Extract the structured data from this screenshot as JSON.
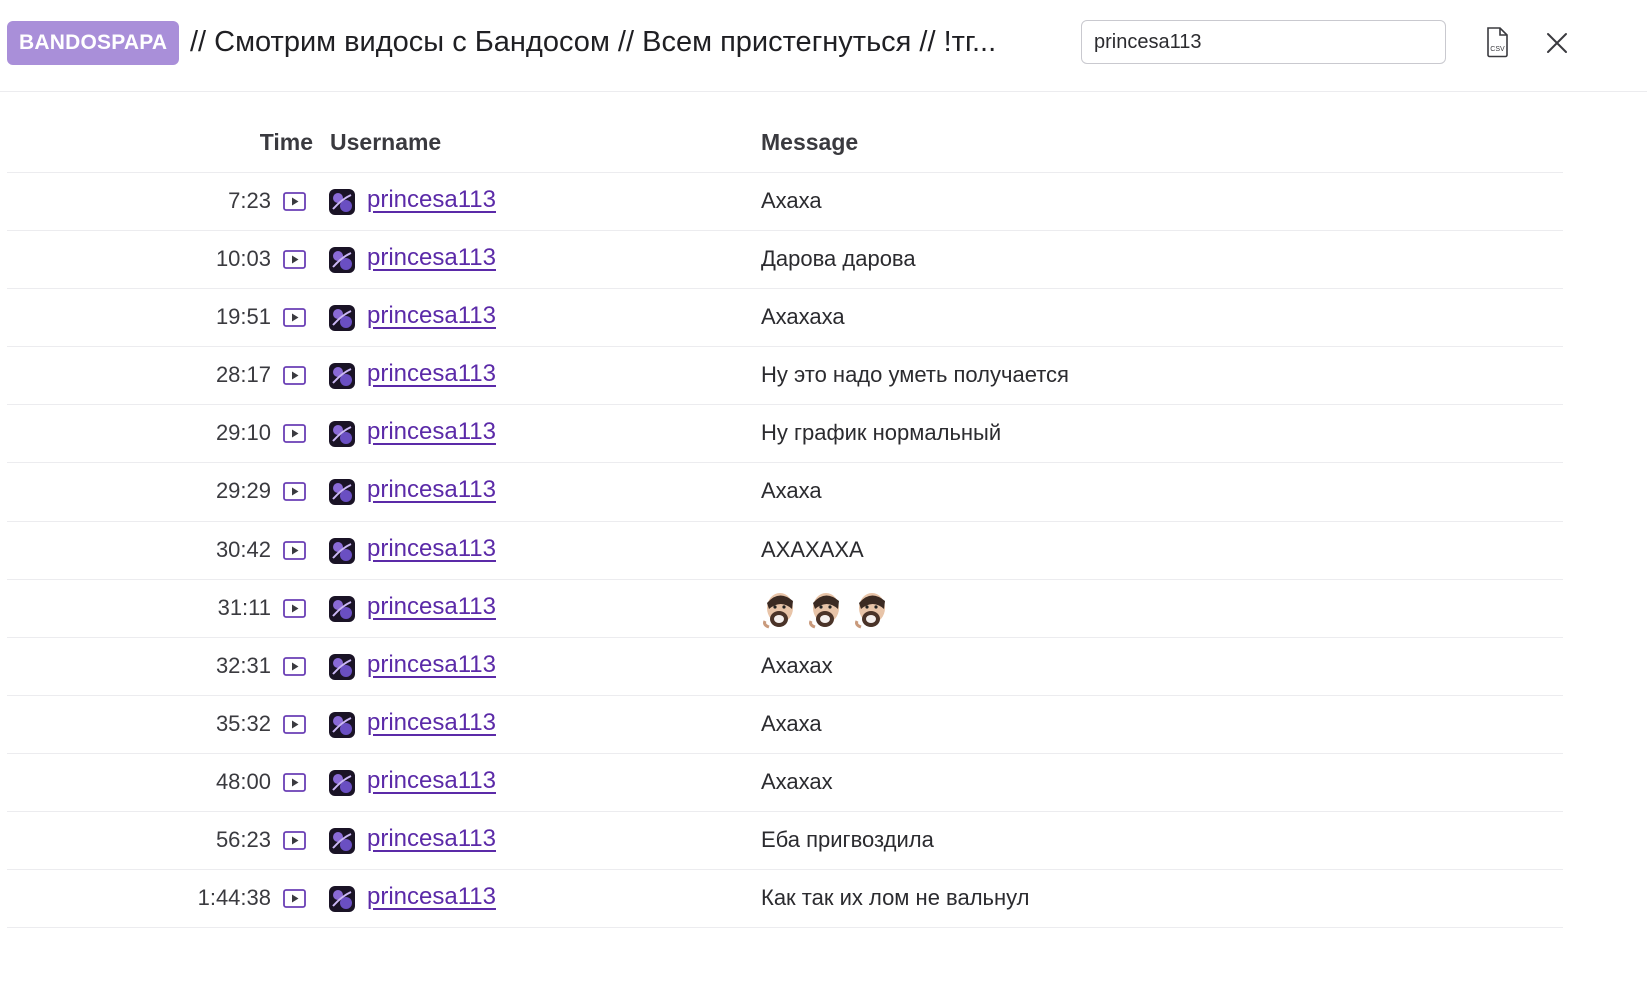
{
  "header": {
    "channel": "BANDOSPAPA",
    "title": "// Смотрим видосы с Бандосом // Всем пристегнуться // !тг...",
    "search_value": "princesa113",
    "csv_label": "CSV",
    "csv_icon": "csv-file-icon",
    "close_icon": "close-icon"
  },
  "colors": {
    "badge": "#a98fd9",
    "username": "#5b2aa8",
    "play": "#6a3fb5"
  },
  "table": {
    "columns": {
      "time": "Time",
      "username": "Username",
      "message": "Message"
    },
    "rows": [
      {
        "time": "7:23",
        "username": "princesa113",
        "message": "Ахаха"
      },
      {
        "time": "10:03",
        "username": "princesa113",
        "message": "Дарова дарова"
      },
      {
        "time": "19:51",
        "username": "princesa113",
        "message": "Ахахаха"
      },
      {
        "time": "28:17",
        "username": "princesa113",
        "message": "Ну это надо уметь получается"
      },
      {
        "time": "29:10",
        "username": "princesa113",
        "message": "Ну график нормальный"
      },
      {
        "time": "29:29",
        "username": "princesa113",
        "message": "Ахаха"
      },
      {
        "time": "30:42",
        "username": "princesa113",
        "message": "АХАХАХА"
      },
      {
        "time": "31:11",
        "username": "princesa113",
        "message": "",
        "emotes": [
          "laughing-man-emote",
          "laughing-man-emote",
          "laughing-man-emote"
        ]
      },
      {
        "time": "32:31",
        "username": "princesa113",
        "message": "Ахахах"
      },
      {
        "time": "35:32",
        "username": "princesa113",
        "message": "Ахаха"
      },
      {
        "time": "48:00",
        "username": "princesa113",
        "message": "Ахахах"
      },
      {
        "time": "56:23",
        "username": "princesa113",
        "message": "Еба пригвоздила"
      },
      {
        "time": "1:44:38",
        "username": "princesa113",
        "message": "Как так их лом не вальнул"
      }
    ]
  }
}
